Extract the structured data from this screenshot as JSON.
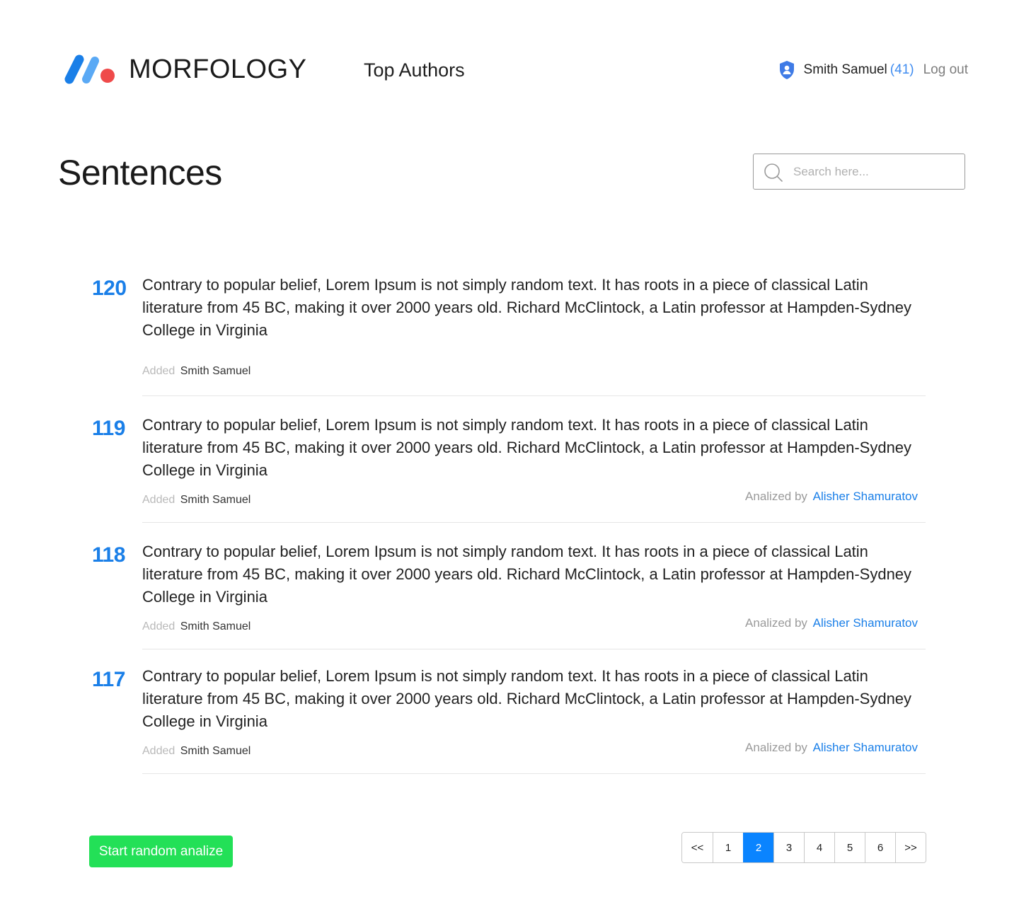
{
  "brand": {
    "name": "MORFOLOGY",
    "colors": {
      "blue_dark": "#1a7fe8",
      "blue_light": "#5aa9f5",
      "red": "#ef4a4a"
    }
  },
  "nav": {
    "top_authors": "Top Authors"
  },
  "user": {
    "icon": "shield-user-icon",
    "name": "Smith Samuel",
    "count": "(41)",
    "logout": "Log out"
  },
  "page": {
    "title": "Sentences"
  },
  "search": {
    "placeholder": "Search here...",
    "icon": "search-icon"
  },
  "sentences": [
    {
      "id": "120",
      "text": "Contrary to popular belief, Lorem Ipsum is not simply random text. It has roots in a piece of classical Latin literature from 45 BC, making it over 2000 years old. Richard McClintock, a Latin professor at Hampden-Sydney College in Virginia",
      "added_label": "Added",
      "added_by": "Smith Samuel"
    },
    {
      "id": "119",
      "text": "Contrary to popular belief, Lorem Ipsum is not simply random text. It has roots in a piece of classical Latin literature from 45 BC, making it over 2000 years old. Richard McClintock, a Latin professor at Hampden-Sydney College in Virginia",
      "added_label": "Added",
      "added_by": "Smith Samuel",
      "analyzed_label": "Analized by",
      "analyzed_by": "Alisher Shamuratov"
    },
    {
      "id": "118",
      "text": "Contrary to popular belief, Lorem Ipsum is not simply random text. It has roots in a piece of classical Latin literature from 45 BC, making it over 2000 years old. Richard McClintock, a Latin professor at Hampden-Sydney College in Virginia",
      "added_label": "Added",
      "added_by": "Smith Samuel",
      "analyzed_label": "Analized by",
      "analyzed_by": "Alisher Shamuratov"
    },
    {
      "id": "117",
      "text": "Contrary to popular belief, Lorem Ipsum is not simply random text. It has roots in a piece of classical Latin literature from 45 BC, making it over 2000 years old. Richard McClintock, a Latin professor at Hampden-Sydney College in Virginia",
      "added_label": "Added",
      "added_by": "Smith Samuel",
      "analyzed_label": "Analized by",
      "analyzed_by": "Alisher Shamuratov"
    }
  ],
  "actions": {
    "start_random": "Start random analize",
    "start_color": "#23e057"
  },
  "pagination": {
    "prev": "<<",
    "pages": [
      "1",
      "2",
      "3",
      "4",
      "5",
      "6"
    ],
    "current": "2",
    "next": ">>",
    "active_color": "#0a84ff"
  }
}
